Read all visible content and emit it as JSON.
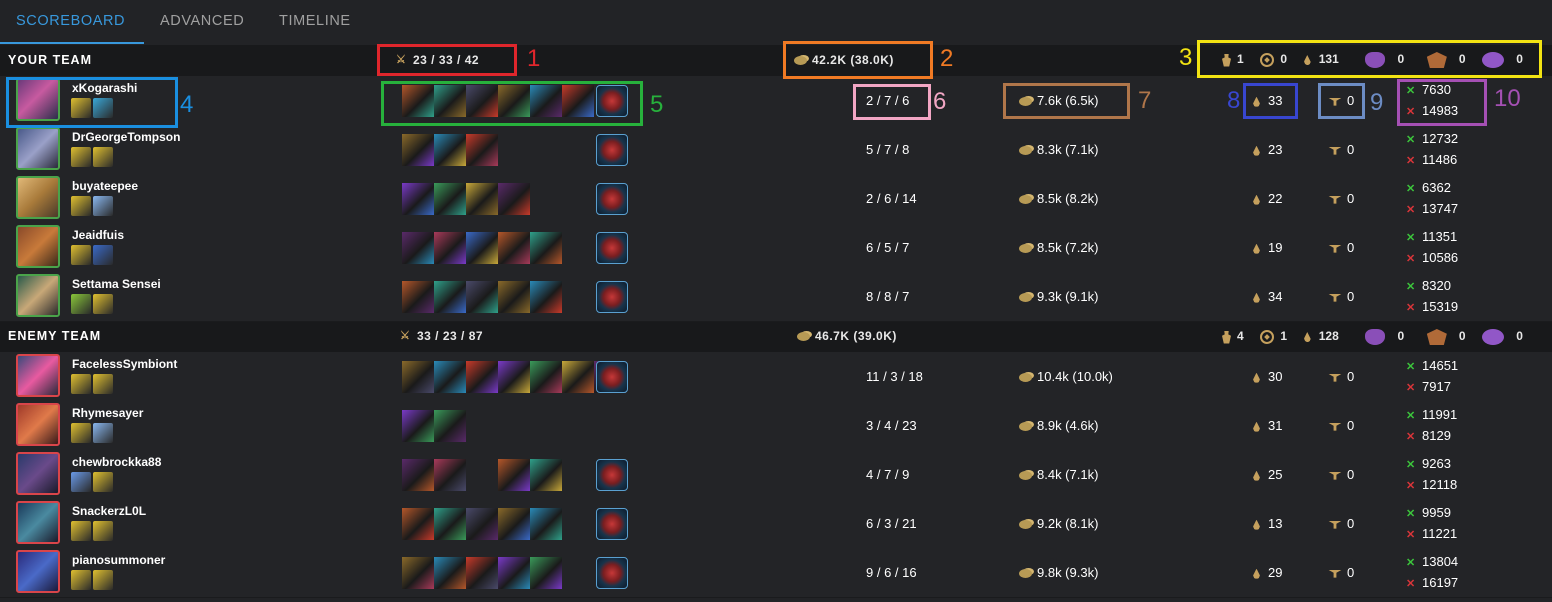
{
  "tabs": [
    {
      "label": "SCOREBOARD",
      "active": true
    },
    {
      "label": "ADVANCED",
      "active": false
    },
    {
      "label": "TIMELINE",
      "active": false
    }
  ],
  "teams": [
    {
      "title": "YOUR TEAM",
      "kda": "23 / 33 / 42",
      "gold": "42.2K (38.0K)",
      "objectives": {
        "towers": "1",
        "inhibitors": "0",
        "cs": "131",
        "barons": "0",
        "dragons": "0",
        "heralds": "0"
      },
      "players": [
        {
          "name": "xKogarashi",
          "kda": "2 / 7 / 6",
          "gold": "7.6k (6.5k)",
          "cs": "33",
          "wards": "0",
          "damage_dealt": "7630",
          "damage_taken": "14983"
        },
        {
          "name": "DrGeorgeTompson",
          "kda": "5 / 7 / 8",
          "gold": "8.3k (7.1k)",
          "cs": "23",
          "wards": "0",
          "damage_dealt": "12732",
          "damage_taken": "11486"
        },
        {
          "name": "buyateepee",
          "kda": "2 / 6 / 14",
          "gold": "8.5k (8.2k)",
          "cs": "22",
          "wards": "0",
          "damage_dealt": "6362",
          "damage_taken": "13747"
        },
        {
          "name": "Jeaidfuis",
          "kda": "6 / 5 / 7",
          "gold": "8.5k (7.2k)",
          "cs": "19",
          "wards": "0",
          "damage_dealt": "11351",
          "damage_taken": "10586"
        },
        {
          "name": "Settama Sensei",
          "kda": "8 / 8 / 7",
          "gold": "9.3k (9.1k)",
          "cs": "34",
          "wards": "0",
          "damage_dealt": "8320",
          "damage_taken": "15319"
        }
      ]
    },
    {
      "title": "ENEMY TEAM",
      "kda": "33 / 23 / 87",
      "gold": "46.7K (39.0K)",
      "objectives": {
        "towers": "4",
        "inhibitors": "1",
        "cs": "128",
        "barons": "0",
        "dragons": "0",
        "heralds": "0"
      },
      "players": [
        {
          "name": "FacelessSymbiont",
          "kda": "11 / 3 / 18",
          "gold": "10.4k (10.0k)",
          "cs": "30",
          "wards": "0",
          "damage_dealt": "14651",
          "damage_taken": "7917"
        },
        {
          "name": "Rhymesayer",
          "kda": "3 / 4 / 23",
          "gold": "8.9k (4.6k)",
          "cs": "31",
          "wards": "0",
          "damage_dealt": "11991",
          "damage_taken": "8129"
        },
        {
          "name": "chewbrockka88",
          "kda": "4 / 7 / 9",
          "gold": "8.4k (7.1k)",
          "cs": "25",
          "wards": "0",
          "damage_dealt": "9263",
          "damage_taken": "12118"
        },
        {
          "name": "SnackerzL0L",
          "kda": "6 / 3 / 21",
          "gold": "9.2k (8.1k)",
          "cs": "13",
          "wards": "0",
          "damage_dealt": "9959",
          "damage_taken": "11221"
        },
        {
          "name": "pianosummoner",
          "kda": "9 / 6 / 16",
          "gold": "9.8k (9.3k)",
          "cs": "29",
          "wards": "0",
          "damage_dealt": "13804",
          "damage_taken": "16197"
        }
      ]
    }
  ],
  "annotations": [
    {
      "label": "1",
      "color": "#e0262c"
    },
    {
      "label": "2",
      "color": "#f07a24"
    },
    {
      "label": "3",
      "color": "#f2e313"
    },
    {
      "label": "4",
      "color": "#1a8fe0"
    },
    {
      "label": "5",
      "color": "#27b13c"
    },
    {
      "label": "6",
      "color": "#f2a6c4"
    },
    {
      "label": "7",
      "color": "#b0764a"
    },
    {
      "label": "8",
      "color": "#3846d0"
    },
    {
      "label": "9",
      "color": "#6c8cc4"
    },
    {
      "label": "10",
      "color": "#a550b4"
    }
  ],
  "colors": {
    "accent": "#3898dc",
    "ally_border": "#4aa34a",
    "enemy_border": "#d9454a",
    "damage_dealt_icon": "#3cc43c",
    "damage_taken_icon": "#d8353a",
    "gold_icon": "#c5a05d"
  }
}
